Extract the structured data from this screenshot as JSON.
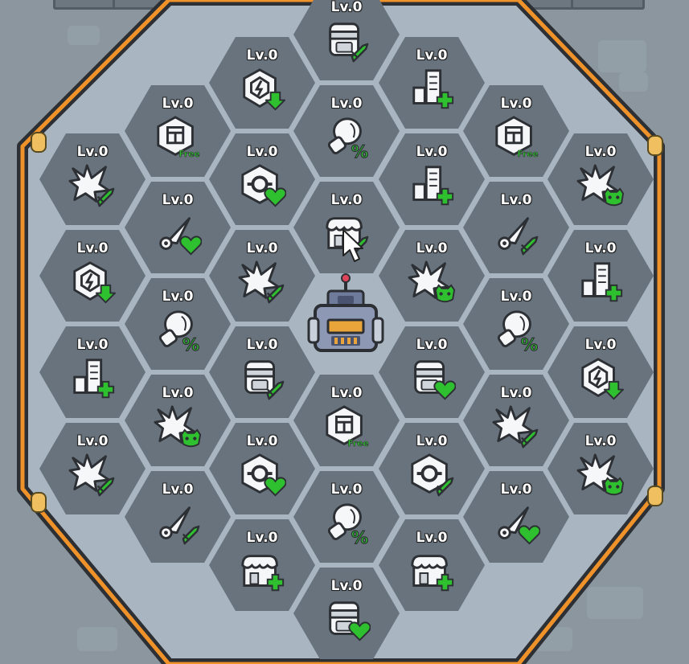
{
  "board": {
    "accent_color": "#f0922a",
    "frame_color": "#2c2f33",
    "floor_color": "#a9b6c1",
    "hex_color": "#68737d",
    "upgrade_green": "#2ec02e"
  },
  "tiles": [
    {
      "id": "t01",
      "level": "Lv.0",
      "icon": "backpack-icon",
      "badge": "sword"
    },
    {
      "id": "t02",
      "level": "Lv.0",
      "icon": "shield-hex-icon",
      "badge": "arrow-down"
    },
    {
      "id": "t03",
      "level": "Lv.0",
      "icon": "building-icon",
      "badge": "plus"
    },
    {
      "id": "t04",
      "level": "Lv.0",
      "icon": "crate-icon",
      "badge": "free",
      "badge_text": "Free"
    },
    {
      "id": "t05",
      "level": "Lv.0",
      "icon": "glove-icon",
      "badge": "percent"
    },
    {
      "id": "t06",
      "level": "Lv.0",
      "icon": "crate-icon",
      "badge": "free",
      "badge_text": "Free"
    },
    {
      "id": "t07",
      "level": "Lv.0",
      "icon": "splat-icon",
      "badge": "sword"
    },
    {
      "id": "t08",
      "level": "Lv.0",
      "icon": "gear-hex-icon",
      "badge": "heart"
    },
    {
      "id": "t09",
      "level": "Lv.0",
      "icon": "building-icon",
      "badge": "plus"
    },
    {
      "id": "t10",
      "level": "Lv.0",
      "icon": "splat-icon",
      "badge": "mask"
    },
    {
      "id": "t11",
      "level": "Lv.0",
      "icon": "pin-icon",
      "badge": "heart"
    },
    {
      "id": "t12",
      "level": "Lv.0",
      "icon": "shop-icon",
      "badge": "sword"
    },
    {
      "id": "t13",
      "level": "Lv.0",
      "icon": "pin-icon",
      "badge": "sword"
    },
    {
      "id": "t14",
      "level": "Lv.0",
      "icon": "shield-hex-icon",
      "badge": "arrow-down"
    },
    {
      "id": "t15",
      "level": "Lv.0",
      "icon": "splat-icon",
      "badge": "sword"
    },
    {
      "id": "t16",
      "level": "Lv.0",
      "icon": "splat-icon",
      "badge": "mask"
    },
    {
      "id": "t17",
      "level": "Lv.0",
      "icon": "building-icon",
      "badge": "plus"
    },
    {
      "id": "t18",
      "level": "Lv.0",
      "icon": "glove-icon",
      "badge": "percent"
    },
    {
      "id": "t19",
      "level": "Lv.0",
      "icon": "glove-icon",
      "badge": "percent"
    },
    {
      "id": "t20",
      "level": "Lv.0",
      "icon": "building-icon",
      "badge": "plus"
    },
    {
      "id": "t21",
      "level": "Lv.0",
      "icon": "backpack-icon",
      "badge": "sword"
    },
    {
      "id": "t22",
      "level": "Lv.0",
      "icon": "backpack-icon",
      "badge": "heart"
    },
    {
      "id": "t23",
      "level": "Lv.0",
      "icon": "shield-hex-icon",
      "badge": "arrow-down"
    },
    {
      "id": "t24",
      "level": "Lv.0",
      "icon": "splat-icon",
      "badge": "mask"
    },
    {
      "id": "t25",
      "level": "Lv.0",
      "icon": "crate-icon",
      "badge": "free",
      "badge_text": "Free"
    },
    {
      "id": "t26",
      "level": "Lv.0",
      "icon": "splat-icon",
      "badge": "sword"
    },
    {
      "id": "t27",
      "level": "Lv.0",
      "icon": "splat-icon",
      "badge": "sword"
    },
    {
      "id": "t28",
      "level": "Lv.0",
      "icon": "gear-hex-icon",
      "badge": "heart"
    },
    {
      "id": "t29",
      "level": "Lv.0",
      "icon": "gear-hex-icon",
      "badge": "sword"
    },
    {
      "id": "t30",
      "level": "Lv.0",
      "icon": "splat-icon",
      "badge": "mask"
    },
    {
      "id": "t31",
      "level": "Lv.0",
      "icon": "pin-icon",
      "badge": "sword"
    },
    {
      "id": "t32",
      "level": "Lv.0",
      "icon": "glove-icon",
      "badge": "percent"
    },
    {
      "id": "t33",
      "level": "Lv.0",
      "icon": "pin-icon",
      "badge": "heart"
    },
    {
      "id": "t34",
      "level": "Lv.0",
      "icon": "shop-icon",
      "badge": "plus"
    },
    {
      "id": "t35",
      "level": "Lv.0",
      "icon": "shop-icon",
      "badge": "plus"
    },
    {
      "id": "t36",
      "level": "Lv.0",
      "icon": "backpack-icon",
      "badge": "heart"
    }
  ],
  "center": {
    "icon": "robot-base-icon"
  }
}
